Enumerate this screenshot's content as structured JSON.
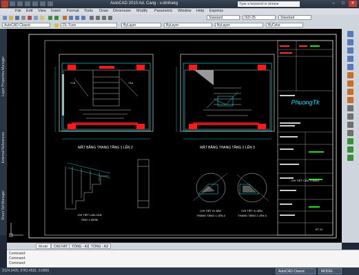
{
  "window": {
    "title": "AutoCAD 2010   Ad. Cang - v.slinhakg",
    "search_placeholder": "Type a keyword or phrase",
    "controls": [
      "–",
      "□",
      "✕"
    ]
  },
  "menu": [
    "File",
    "Edit",
    "View",
    "Insert",
    "Format",
    "Tools",
    "Draw",
    "Dimension",
    "Modify",
    "Parametric",
    "Window",
    "Help",
    "Express"
  ],
  "toolbar": {
    "workspace": "AutoCAD Classic",
    "layer_combo": "DL-Tuon",
    "bylayer_1": "ByLayer",
    "bylayer_2": "ByLayer",
    "bylayer_3": "ByLayer",
    "bycolor": "ByColor",
    "style_combo": "Standard",
    "dim_combo": "ISO-25",
    "table_combo": "Standard"
  },
  "left_palette": [
    "Layer Properties Manager",
    "External References",
    "Sheet Set Manager"
  ],
  "drawing": {
    "titles": {
      "plan_1": "MẶT BẰNG THANG TẦNG 1 LÊN 2",
      "plan_2": "MẶT BẰNG THANG TẦNG 2 LÊN 3",
      "detail_1_a": "CHI TIẾT LAN CAN",
      "detail_1_b": "ỐNG 1-40/36",
      "detail_2_a": "CHI TIẾT 01 BẬC",
      "detail_2_b": "THANG TẦNG 1 LÊN 2",
      "detail_3_a": "CHI TIẾT 01 BẬC",
      "detail_3_b": "THANG TẦNG 2 LÊN 3"
    },
    "watermark": "PhuongTk",
    "title_block": {
      "sheet_name": "CHI TIẾT CẦU THANG",
      "sheet_no": "KT-11"
    }
  },
  "tabs": [
    "Model",
    "CK6 FAT",
    "TỔNG - A1",
    "TỔNG - A3"
  ],
  "command": {
    "line1": "Command:",
    "line2": "Command:",
    "line3": "Command:"
  },
  "status": {
    "coords": "3124.3425, 9781.4531, 0.0000",
    "taskbar": [
      "AutoCAD Classic",
      "MODEL"
    ]
  },
  "colors": {
    "canvas": "#000000",
    "cyan": "#00ffff",
    "red": "#ff1a1a",
    "green": "#22dd22",
    "white": "#ffffff"
  }
}
